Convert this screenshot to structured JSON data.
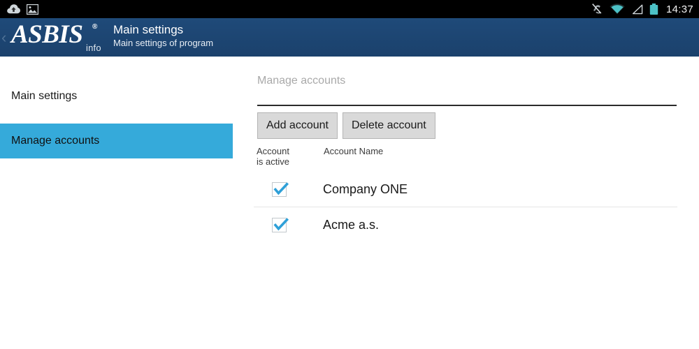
{
  "statusbar": {
    "left_icons": [
      {
        "name": "cloud-upload-icon"
      },
      {
        "name": "image-icon"
      }
    ],
    "right_icons": [
      {
        "name": "silent-mode-icon"
      },
      {
        "name": "wifi-icon"
      },
      {
        "name": "signal-icon"
      },
      {
        "name": "battery-icon"
      }
    ],
    "clock": "14:37",
    "background": "#000000",
    "accent": "#4cc1c6"
  },
  "appbar": {
    "back_label": "‹",
    "logo_text": "ASBIS",
    "logo_registered": "®",
    "logo_subtext": "info",
    "title": "Main settings",
    "subtitle": "Main settings of program",
    "background": "#1d4572"
  },
  "sidebar": {
    "items": [
      {
        "label": "Main settings",
        "selected": false
      },
      {
        "label": "Manage accounts",
        "selected": true
      }
    ],
    "selected_color": "#35aada"
  },
  "main": {
    "section_title": "Manage accounts",
    "buttons": [
      {
        "label": "Add account",
        "name": "add-account-button"
      },
      {
        "label": "Delete account",
        "name": "delete-account-button"
      }
    ],
    "columns": {
      "active_line1": "Account",
      "active_line2": "is active",
      "name": "Account Name"
    },
    "rows": [
      {
        "active": true,
        "name": "Company ONE"
      },
      {
        "active": true,
        "name": "Acme a.s."
      }
    ],
    "checkbox_color": "#2fa0d8"
  }
}
